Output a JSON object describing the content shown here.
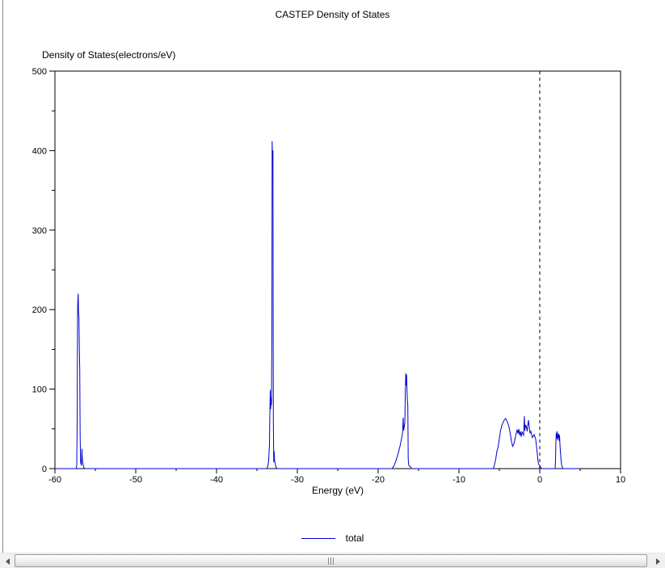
{
  "window": {
    "background": "#ffffff",
    "border_color": "#8f8f8f"
  },
  "chart_data": {
    "type": "line",
    "title": "CASTEP Density of States",
    "xlabel": "Energy (eV)",
    "ylabel": "Density of States(electrons/eV)",
    "xlim": [
      -60,
      10
    ],
    "ylim": [
      0,
      500
    ],
    "x_ticks": [
      -60,
      -50,
      -40,
      -30,
      -20,
      -10,
      0,
      10
    ],
    "x_minor_step": 5,
    "y_ticks": [
      0,
      100,
      200,
      300,
      400,
      500
    ],
    "y_minor_step": 50,
    "grid": false,
    "axis_color": "#000000",
    "fermi_line": {
      "x": 0,
      "style": "dashed",
      "color": "#000000"
    },
    "legend": {
      "position": "bottom-center",
      "entries": [
        {
          "label": "total",
          "color": "#0000cc"
        }
      ]
    },
    "series": [
      {
        "name": "total",
        "color": "#0000cc",
        "points": [
          [
            -60,
            0
          ],
          [
            -57.6,
            0
          ],
          [
            -57.35,
            0
          ],
          [
            -57.3,
            5
          ],
          [
            -57.25,
            60
          ],
          [
            -57.2,
            195
          ],
          [
            -57.17,
            210
          ],
          [
            -57.12,
            220
          ],
          [
            -57.08,
            196
          ],
          [
            -57.03,
            190
          ],
          [
            -56.98,
            150
          ],
          [
            -56.93,
            124
          ],
          [
            -56.88,
            40
          ],
          [
            -56.83,
            8
          ],
          [
            -56.72,
            4
          ],
          [
            -56.66,
            25
          ],
          [
            -56.6,
            10
          ],
          [
            -56.45,
            2
          ],
          [
            -56.3,
            0
          ],
          [
            -33.8,
            0
          ],
          [
            -33.65,
            3
          ],
          [
            -33.55,
            10
          ],
          [
            -33.45,
            30
          ],
          [
            -33.4,
            70
          ],
          [
            -33.35,
            99
          ],
          [
            -33.3,
            75
          ],
          [
            -33.25,
            89
          ],
          [
            -33.2,
            80
          ],
          [
            -33.15,
            170
          ],
          [
            -33.12,
            412
          ],
          [
            -33.07,
            388
          ],
          [
            -33.02,
            400
          ],
          [
            -32.97,
            60
          ],
          [
            -32.92,
            8
          ],
          [
            -32.87,
            22
          ],
          [
            -32.82,
            10
          ],
          [
            -32.65,
            2
          ],
          [
            -32.5,
            0
          ],
          [
            -18.3,
            0
          ],
          [
            -18.05,
            3
          ],
          [
            -17.8,
            10
          ],
          [
            -17.55,
            18
          ],
          [
            -17.3,
            28
          ],
          [
            -17.1,
            38
          ],
          [
            -16.98,
            45
          ],
          [
            -16.9,
            64
          ],
          [
            -16.84,
            48
          ],
          [
            -16.78,
            52
          ],
          [
            -16.7,
            58
          ],
          [
            -16.64,
            95
          ],
          [
            -16.58,
            120
          ],
          [
            -16.53,
            105
          ],
          [
            -16.48,
            118
          ],
          [
            -16.43,
            100
          ],
          [
            -16.38,
            85
          ],
          [
            -16.33,
            80
          ],
          [
            -16.28,
            12
          ],
          [
            -16.2,
            4
          ],
          [
            -16.0,
            2
          ],
          [
            -15.85,
            0
          ],
          [
            -5.75,
            0
          ],
          [
            -5.6,
            5
          ],
          [
            -5.45,
            12
          ],
          [
            -5.3,
            22
          ],
          [
            -5.15,
            27
          ],
          [
            -5.0,
            38
          ],
          [
            -4.85,
            48
          ],
          [
            -4.7,
            54
          ],
          [
            -4.55,
            58
          ],
          [
            -4.4,
            61
          ],
          [
            -4.25,
            63
          ],
          [
            -4.1,
            61
          ],
          [
            -3.95,
            57
          ],
          [
            -3.8,
            52
          ],
          [
            -3.65,
            44
          ],
          [
            -3.5,
            34
          ],
          [
            -3.35,
            28
          ],
          [
            -3.2,
            31
          ],
          [
            -3.05,
            38
          ],
          [
            -2.9,
            45
          ],
          [
            -2.8,
            49
          ],
          [
            -2.7,
            44
          ],
          [
            -2.6,
            50
          ],
          [
            -2.5,
            42
          ],
          [
            -2.4,
            47
          ],
          [
            -2.3,
            40
          ],
          [
            -2.2,
            46
          ],
          [
            -2.1,
            44
          ],
          [
            -2.0,
            42
          ],
          [
            -1.9,
            66
          ],
          [
            -1.85,
            48
          ],
          [
            -1.75,
            55
          ],
          [
            -1.65,
            52
          ],
          [
            -1.55,
            47
          ],
          [
            -1.5,
            53
          ],
          [
            -1.4,
            61
          ],
          [
            -1.3,
            52
          ],
          [
            -1.2,
            45
          ],
          [
            -1.1,
            47
          ],
          [
            -1.0,
            42
          ],
          [
            -0.9,
            39
          ],
          [
            -0.8,
            41
          ],
          [
            -0.7,
            43
          ],
          [
            -0.6,
            40
          ],
          [
            -0.5,
            37
          ],
          [
            -0.4,
            28
          ],
          [
            -0.3,
            18
          ],
          [
            -0.2,
            8
          ],
          [
            -0.1,
            5
          ],
          [
            0.0,
            4
          ],
          [
            0.1,
            2
          ],
          [
            0.25,
            0
          ],
          [
            1.9,
            0
          ],
          [
            1.95,
            10
          ],
          [
            2.0,
            35
          ],
          [
            2.05,
            45
          ],
          [
            2.1,
            38
          ],
          [
            2.15,
            47
          ],
          [
            2.2,
            36
          ],
          [
            2.25,
            43
          ],
          [
            2.3,
            39
          ],
          [
            2.35,
            44
          ],
          [
            2.4,
            35
          ],
          [
            2.45,
            42
          ],
          [
            2.5,
            30
          ],
          [
            2.6,
            15
          ],
          [
            2.7,
            5
          ],
          [
            2.85,
            0
          ],
          [
            5.0,
            0
          ]
        ]
      }
    ]
  }
}
